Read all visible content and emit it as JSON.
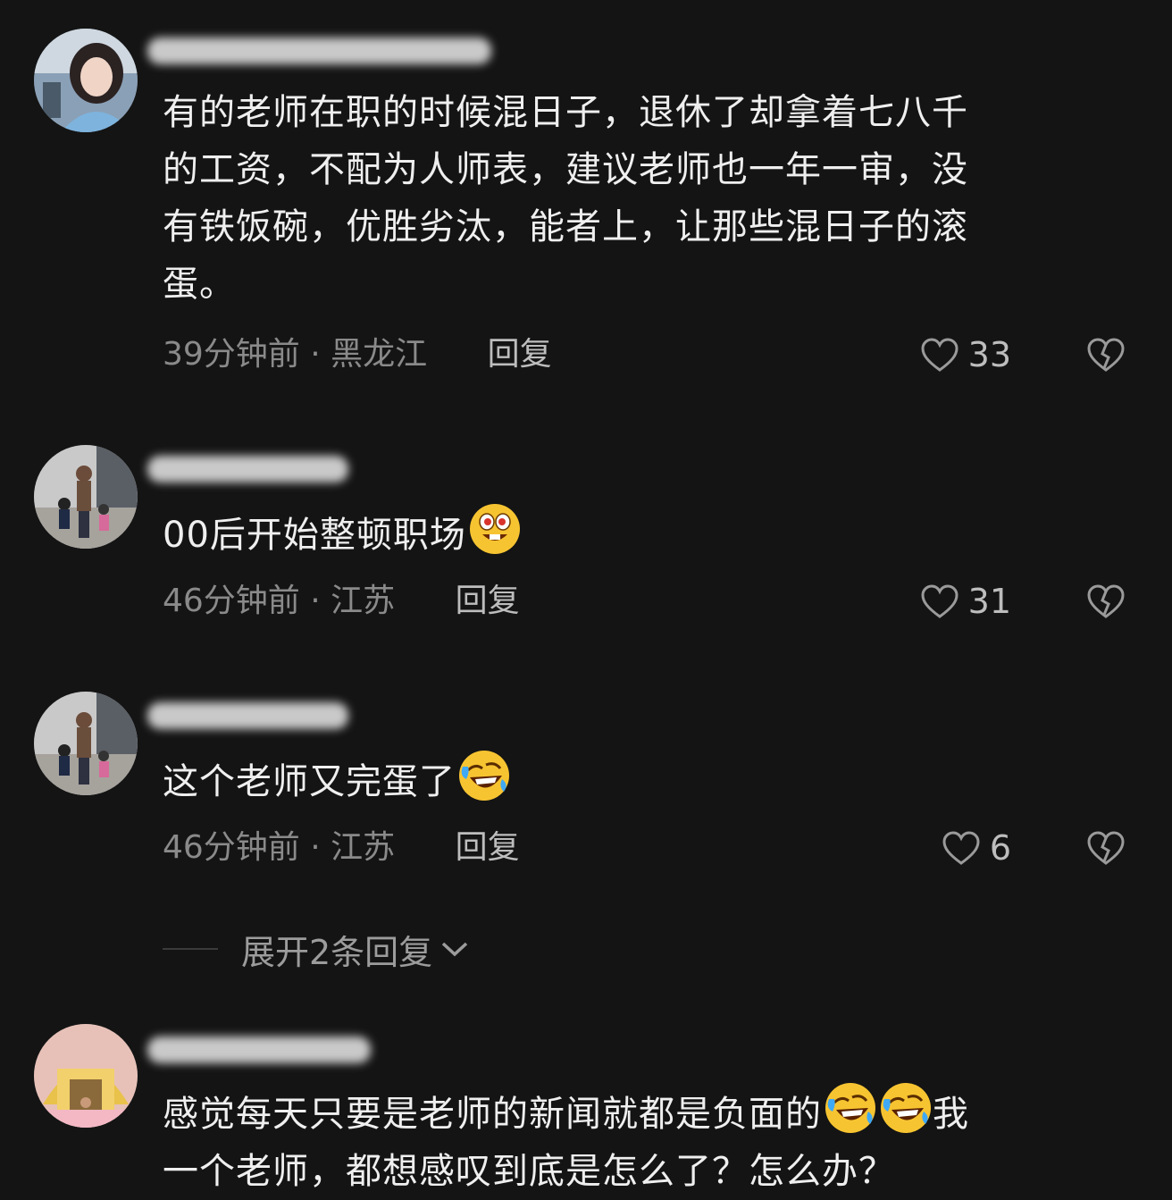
{
  "comments": [
    {
      "text_lines": [
        "有的老师在职的时候混日子，退休了却拿着七八千",
        "的工资，不配为人师表，建议老师也一年一审，没",
        "有铁饭碗，优胜劣汰，能者上，让那些混日子的滚",
        "蛋。"
      ],
      "time": "39分钟前",
      "separator": "·",
      "location": "黑龙江",
      "reply_label": "回复",
      "likes": "33"
    },
    {
      "text_lines": [
        "00后开始整顿职场"
      ],
      "emoji": "grinning-eyes-emoji",
      "time": "46分钟前",
      "separator": "·",
      "location": "江苏",
      "reply_label": "回复",
      "likes": "31"
    },
    {
      "text_lines": [
        "这个老师又完蛋了"
      ],
      "emoji": "rolling-laughing-emoji",
      "time": "46分钟前",
      "separator": "·",
      "location": "江苏",
      "reply_label": "回复",
      "likes": "6"
    },
    {
      "text_line1_a": "感觉每天只要是老师的新闻就都是负面的",
      "text_line1_b": "我",
      "text_line2": "一个老师，都想感叹到底是怎么了？怎么办？",
      "emoji": "rolling-laughing-emoji"
    }
  ],
  "expand_replies_label": "展开2条回复",
  "icons": {
    "like": "heart-outline-icon",
    "dislike": "broken-heart-icon",
    "expand": "chevron-down-icon"
  },
  "colors": {
    "background": "#141414",
    "text": "#efefef",
    "meta": "#8a8a8a",
    "emoji_yellow": "#f7c431"
  }
}
